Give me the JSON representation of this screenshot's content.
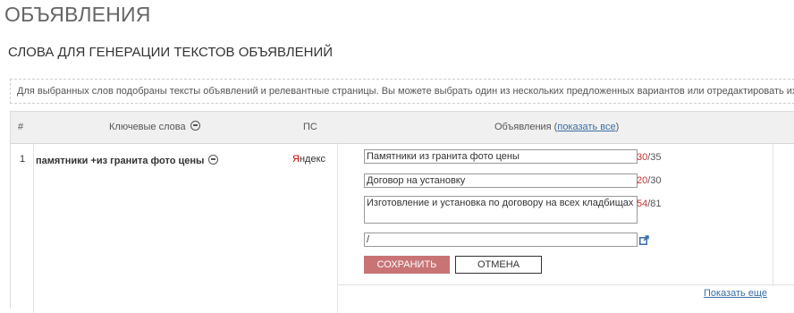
{
  "page": {
    "title": "ОБЪЯВЛЕНИЯ",
    "section_title": "СЛОВА ДЛЯ ГЕНЕРАЦИИ ТЕКСТОВ ОБЪЯВЛЕНИЙ"
  },
  "info": {
    "text": "Для выбранных слов подобраны тексты объявлений и релевантные страницы. Вы можете выбрать один из нескольких предложенных вариантов или отредактировать их"
  },
  "table": {
    "headers": {
      "num": "#",
      "keywords": "Ключевые слова",
      "engine": "ПС",
      "ads_prefix": "Объявления (",
      "ads_link": "показать все",
      "ads_suffix": ")"
    },
    "row": {
      "num": "1",
      "keyword": "памятники +из гранита фото цены",
      "engine_first": "Я",
      "engine_rest": "ндекс",
      "title_value": "Памятники из гранита фото цены",
      "title_count": "30",
      "title_max": "/35",
      "title2_value": "Договор на установку",
      "title2_count": "20",
      "title2_max": "/30",
      "text_value": "Изготовление и установка по договору на всех кладбищах",
      "text_count": "54",
      "text_max": "/81",
      "url_value": "/"
    },
    "buttons": {
      "save": "СОХРАНИТЬ",
      "cancel": "ОТМЕНА"
    },
    "show_more": "Показать еще"
  }
}
